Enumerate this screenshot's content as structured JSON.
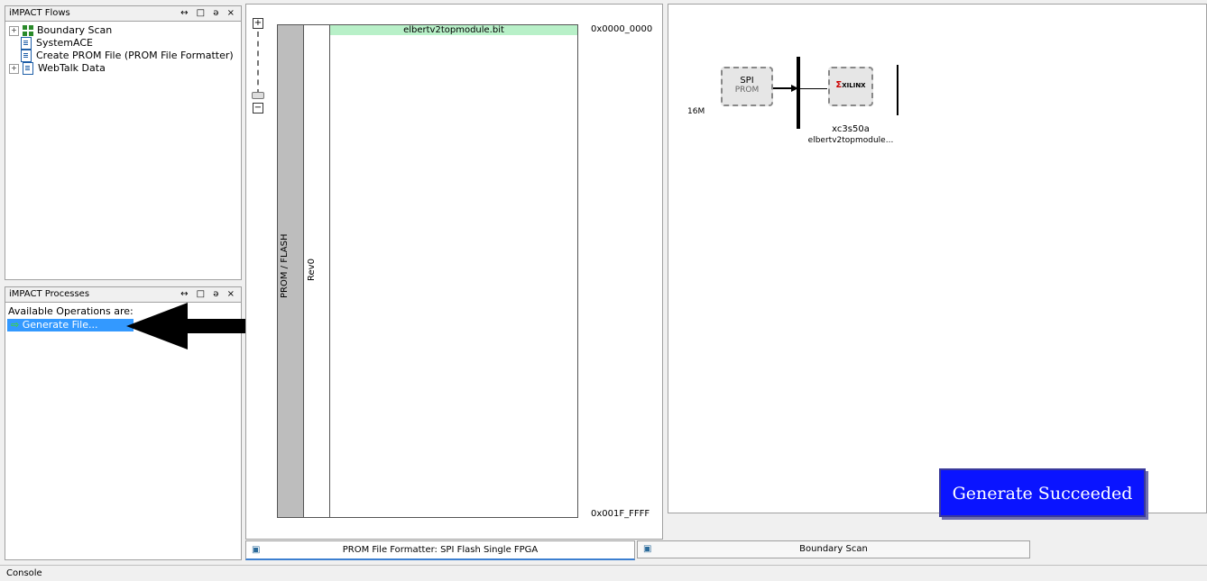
{
  "flows_panel": {
    "title": "iMPACT Flows",
    "controls": "↔ □ ə ×",
    "items": [
      {
        "label": "Boundary Scan",
        "expander": "⊞",
        "icon": "boundary-scan-icon"
      },
      {
        "label": "SystemACE",
        "icon": "document-icon"
      },
      {
        "label": "Create PROM File (PROM File Formatter)",
        "icon": "document-icon"
      },
      {
        "label": "WebTalk Data",
        "expander": "⊞",
        "icon": "document-icon"
      }
    ]
  },
  "processes_panel": {
    "title": "iMPACT Processes",
    "controls": "↔ □ ə ×",
    "header": "Available Operations are:",
    "items": [
      {
        "label": "Generate File...",
        "icon": "green-arrow-icon"
      }
    ]
  },
  "zoom": {
    "plus": "+",
    "minus": "−"
  },
  "prom": {
    "column_label": "PROM / FLASH",
    "rev_label": "Rev0",
    "file_label": "elbertv2topmodule.bit",
    "start_address": "0x0000_0000",
    "end_address": "0x001F_FFFF"
  },
  "boundary": {
    "size_label": "16M",
    "spi_chip_line1": "SPI",
    "spi_chip_line2": "PROM",
    "xilinx_logo": "XILINX",
    "device_name": "xc3s50a",
    "device_file": "elbertv2topmodule..."
  },
  "generate_status": "Generate Succeeded",
  "tabs": [
    {
      "label": "PROM File Formatter: SPI Flash Single FPGA",
      "active": true
    },
    {
      "label": "Boundary Scan",
      "active": false
    }
  ],
  "console_label": "Console",
  "colors": {
    "selection": "#3399ff",
    "file_bar": "#b8f0c8",
    "status_button": "#0a14ff",
    "prom_column": "#bdbdbd"
  }
}
